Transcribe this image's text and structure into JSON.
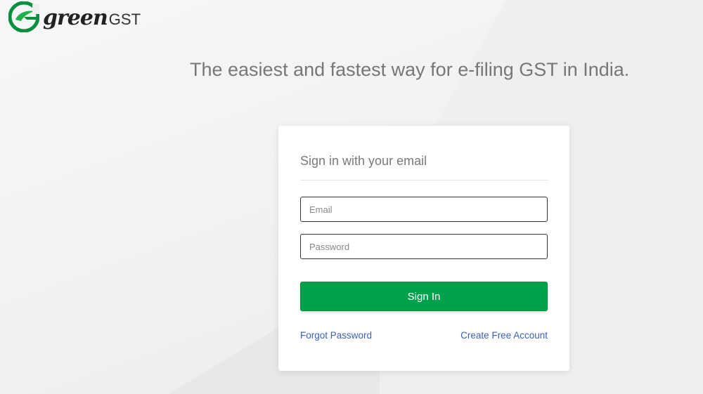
{
  "brand": {
    "name_script": "green",
    "name_suffix": "GST",
    "accent_color": "#00a14b"
  },
  "tagline": "The easiest and fastest way for e-filing GST in India.",
  "login": {
    "title": "Sign in with your email",
    "email_placeholder": "Email",
    "email_value": "",
    "password_placeholder": "Password",
    "password_value": "",
    "submit_label": "Sign In",
    "forgot_label": "Forgot Password",
    "create_label": "Create Free Account",
    "link_color": "#3b5eb8"
  },
  "icons": {
    "logo": "greengst-logo-icon"
  }
}
